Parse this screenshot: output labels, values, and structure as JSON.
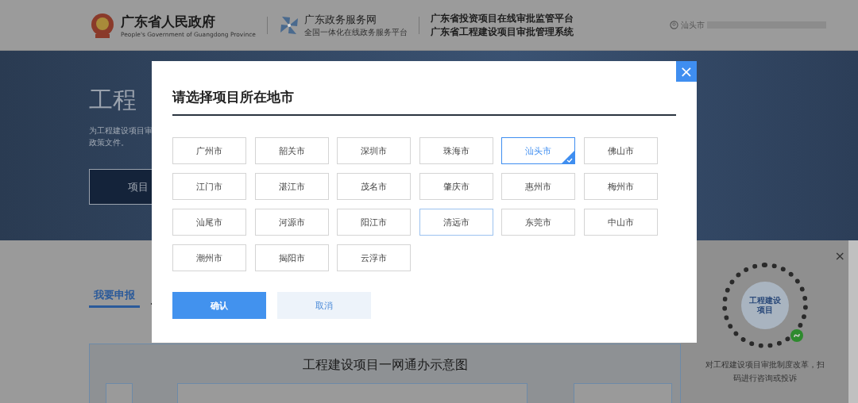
{
  "header": {
    "gov_name": "广东省人民政府",
    "gov_subtitle": "People's Government of Guangdong Province",
    "service_name": "广东政务服务网",
    "service_subtitle": "全国一体化在线政务服务平台",
    "platform_lines": [
      "广东省投资项目在线审批监管平台",
      "广东省工程建设项目审批管理系统"
    ],
    "user_city": "汕头市"
  },
  "hero": {
    "title": "工程",
    "description_lines": [
      "为工程建设项目审",
      "政策文件。"
    ],
    "button": "项目"
  },
  "tabs": [
    {
      "label": "我要申报",
      "selected": true
    }
  ],
  "diagram": {
    "title": "工程建设项目一网通办示意图"
  },
  "qr_panel": {
    "close": "×",
    "caption": "对工程建设项目审批制度改革，扫码进行咨询或投诉",
    "qr_label_lines": [
      "工程建设",
      "项目"
    ]
  },
  "dialog": {
    "title": "请选择项目所在地市",
    "close": "×",
    "cities": [
      {
        "label": "广州市",
        "selected": false,
        "hovered": false
      },
      {
        "label": "韶关市",
        "selected": false,
        "hovered": false
      },
      {
        "label": "深圳市",
        "selected": false,
        "hovered": false
      },
      {
        "label": "珠海市",
        "selected": false,
        "hovered": false
      },
      {
        "label": "汕头市",
        "selected": true,
        "hovered": false
      },
      {
        "label": "佛山市",
        "selected": false,
        "hovered": false
      },
      {
        "label": "江门市",
        "selected": false,
        "hovered": false
      },
      {
        "label": "湛江市",
        "selected": false,
        "hovered": false
      },
      {
        "label": "茂名市",
        "selected": false,
        "hovered": false
      },
      {
        "label": "肇庆市",
        "selected": false,
        "hovered": false
      },
      {
        "label": "惠州市",
        "selected": false,
        "hovered": false
      },
      {
        "label": "梅州市",
        "selected": false,
        "hovered": false
      },
      {
        "label": "汕尾市",
        "selected": false,
        "hovered": false
      },
      {
        "label": "河源市",
        "selected": false,
        "hovered": false
      },
      {
        "label": "阳江市",
        "selected": false,
        "hovered": false
      },
      {
        "label": "清远市",
        "selected": false,
        "hovered": true
      },
      {
        "label": "东莞市",
        "selected": false,
        "hovered": false
      },
      {
        "label": "中山市",
        "selected": false,
        "hovered": false
      },
      {
        "label": "潮州市",
        "selected": false,
        "hovered": false
      },
      {
        "label": "揭阳市",
        "selected": false,
        "hovered": false
      },
      {
        "label": "云浮市",
        "selected": false,
        "hovered": false
      }
    ],
    "confirm": "确认",
    "cancel": "取消"
  }
}
